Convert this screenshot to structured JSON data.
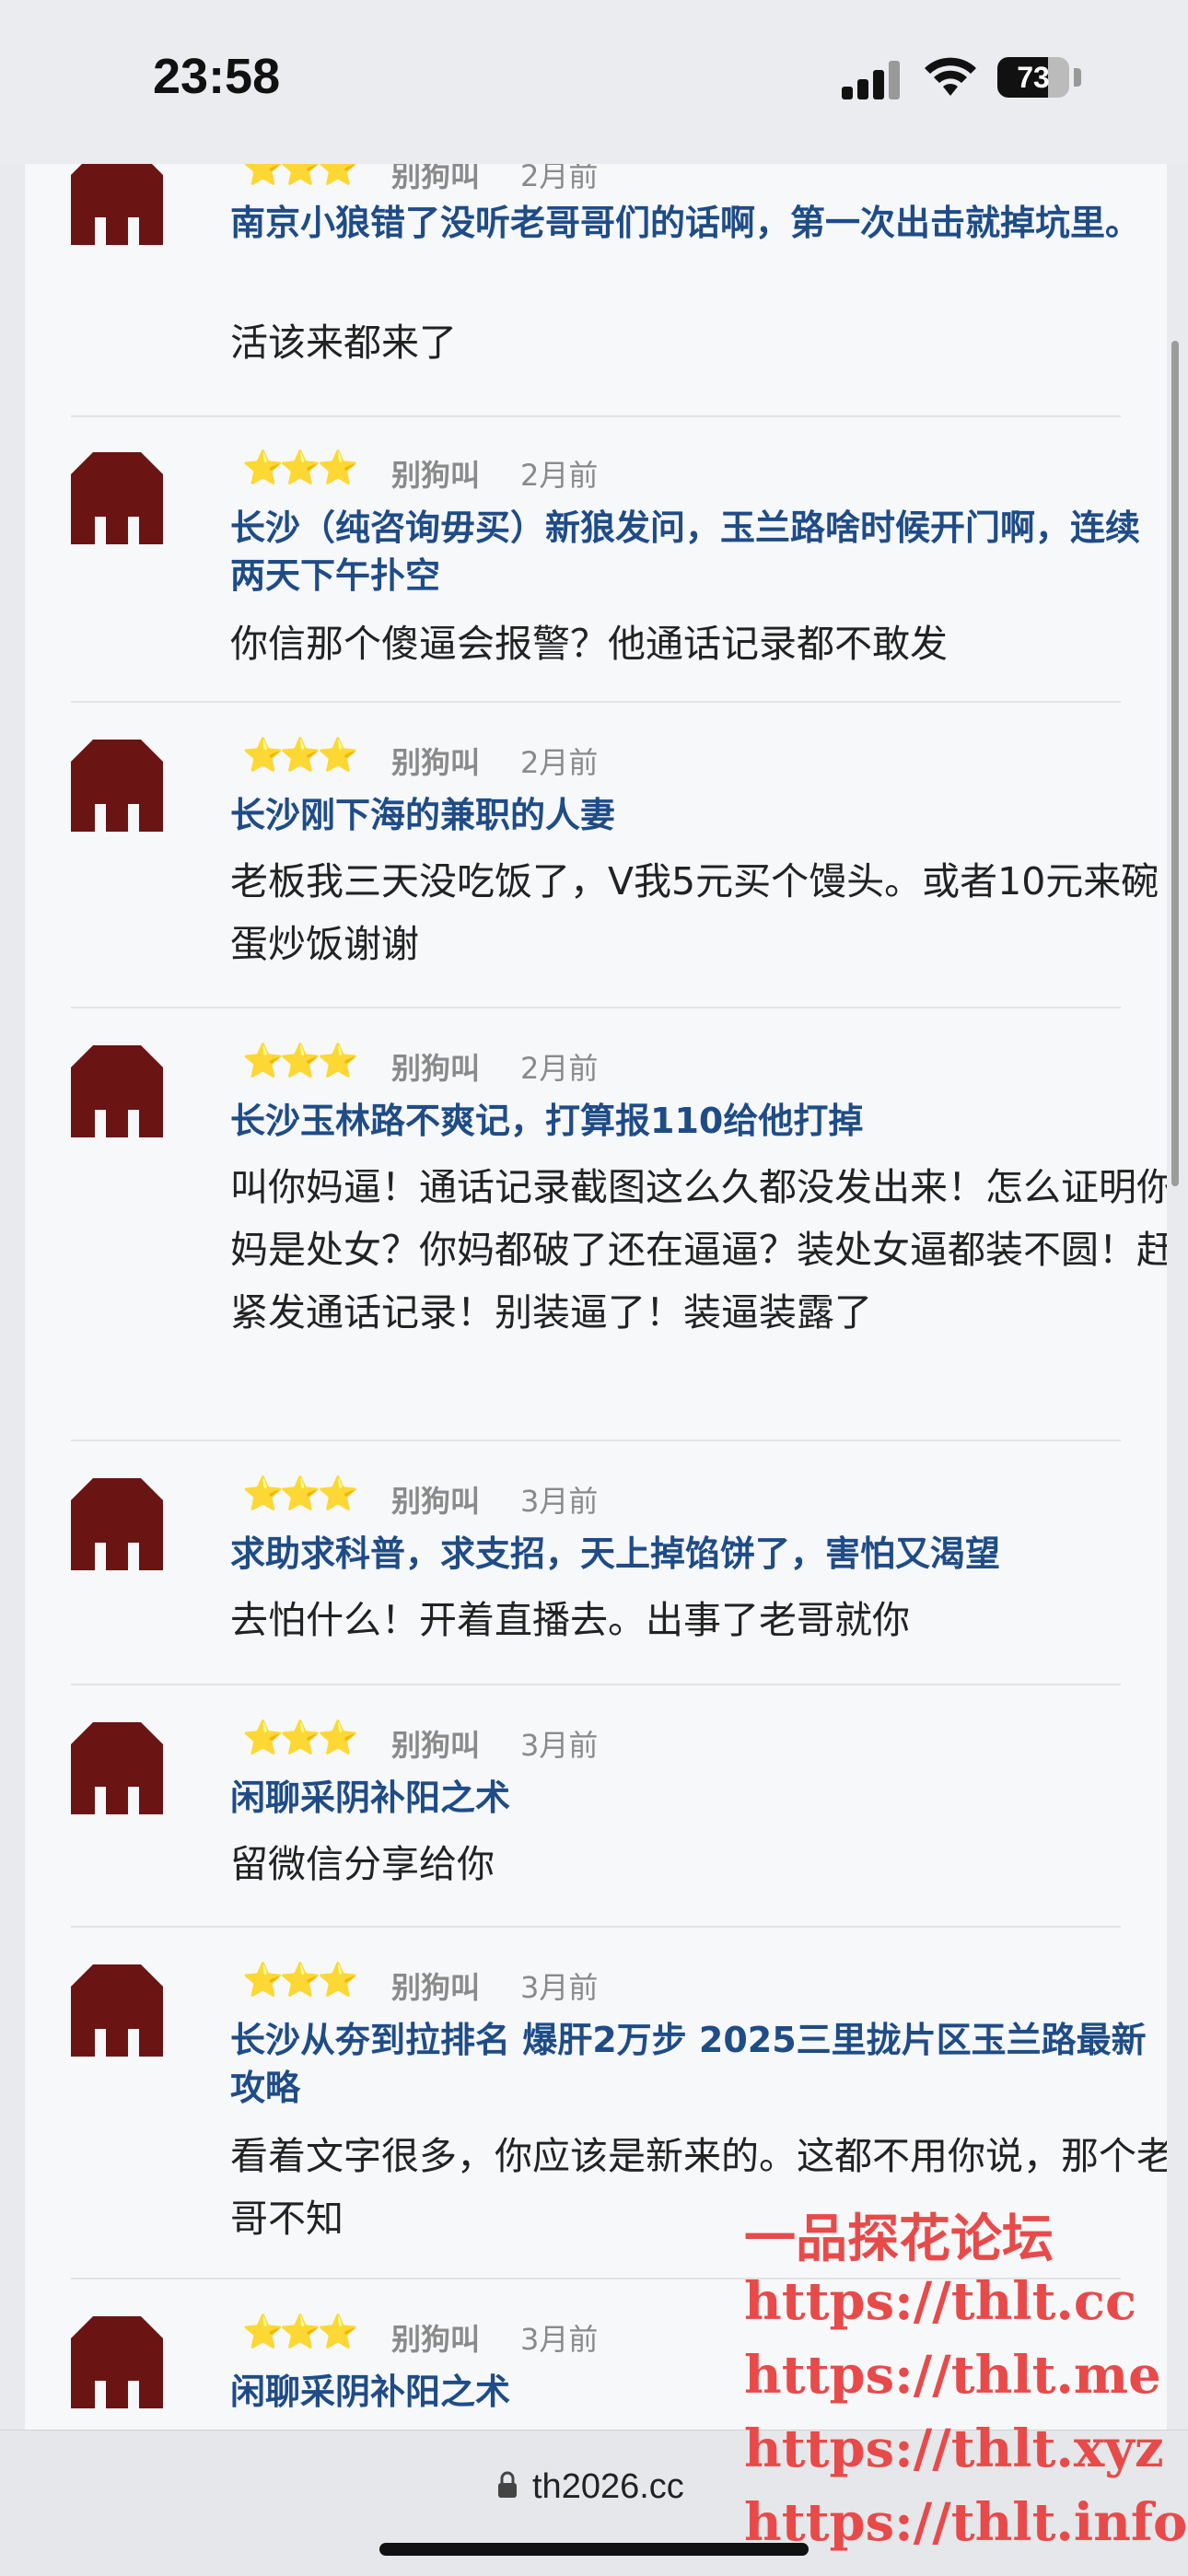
{
  "status": {
    "time": "23:58",
    "battery": "73"
  },
  "comments": [
    {
      "stars": "⭐⭐⭐",
      "author": "别狗叫",
      "ago": "2月前",
      "title": "南京小狼错了没听老哥哥们的话啊，第一次出击就掉坑里。",
      "body": "活该来都来了"
    },
    {
      "stars": "⭐⭐⭐",
      "author": "别狗叫",
      "ago": "2月前",
      "title": "长沙（纯咨询毋买）新狼发问，玉兰路啥时候开门啊，连续两天下午扑空",
      "body": "你信那个傻逼会报警？他通话记录都不敢发"
    },
    {
      "stars": "⭐⭐⭐",
      "author": "别狗叫",
      "ago": "2月前",
      "title": "长沙刚下海的兼职的人妻",
      "body": "老板我三天没吃饭了，V我5元买个馒头。或者10元来碗蛋炒饭谢谢"
    },
    {
      "stars": "⭐⭐⭐",
      "author": "别狗叫",
      "ago": "2月前",
      "title": "长沙玉林路不爽记，打算报110给他打掉",
      "body": "叫你妈逼！通话记录截图这么久都没发出来！怎么证明你妈是处女？你妈都破了还在逼逼？装处女逼都装不圆！赶紧发通话记录！别装逼了！装逼装露了"
    },
    {
      "stars": "⭐⭐⭐",
      "author": "别狗叫",
      "ago": "3月前",
      "title": "求助求科普，求支招，天上掉馅饼了，害怕又渴望",
      "body": "去怕什么！开着直播去。出事了老哥就你"
    },
    {
      "stars": "⭐⭐⭐",
      "author": "别狗叫",
      "ago": "3月前",
      "title": "闲聊采阴补阳之术",
      "body": "留微信分享给你"
    },
    {
      "stars": "⭐⭐⭐",
      "author": "别狗叫",
      "ago": "3月前",
      "title": "长沙从夯到拉排名 爆肝2万步 2025三里拢片区玉兰路最新攻略",
      "body": "看着文字很多，你应该是新来的。这都不用你说，那个老哥不知"
    },
    {
      "stars": "⭐⭐⭐",
      "author": "别狗叫",
      "ago": "3月前",
      "title": "闲聊采阴补阳之术",
      "body": ""
    }
  ],
  "watermark": [
    "一品探花论坛",
    "https://thlt.cc",
    "https://thlt.me",
    "https://thlt.xyz",
    "https://thlt.info"
  ],
  "browser": {
    "url": "th2026.cc"
  },
  "colors": {
    "title": "#1f4c87",
    "meta": "#8a8a8a",
    "avatar": "#6b1414",
    "watermark": "#e84a4a"
  }
}
